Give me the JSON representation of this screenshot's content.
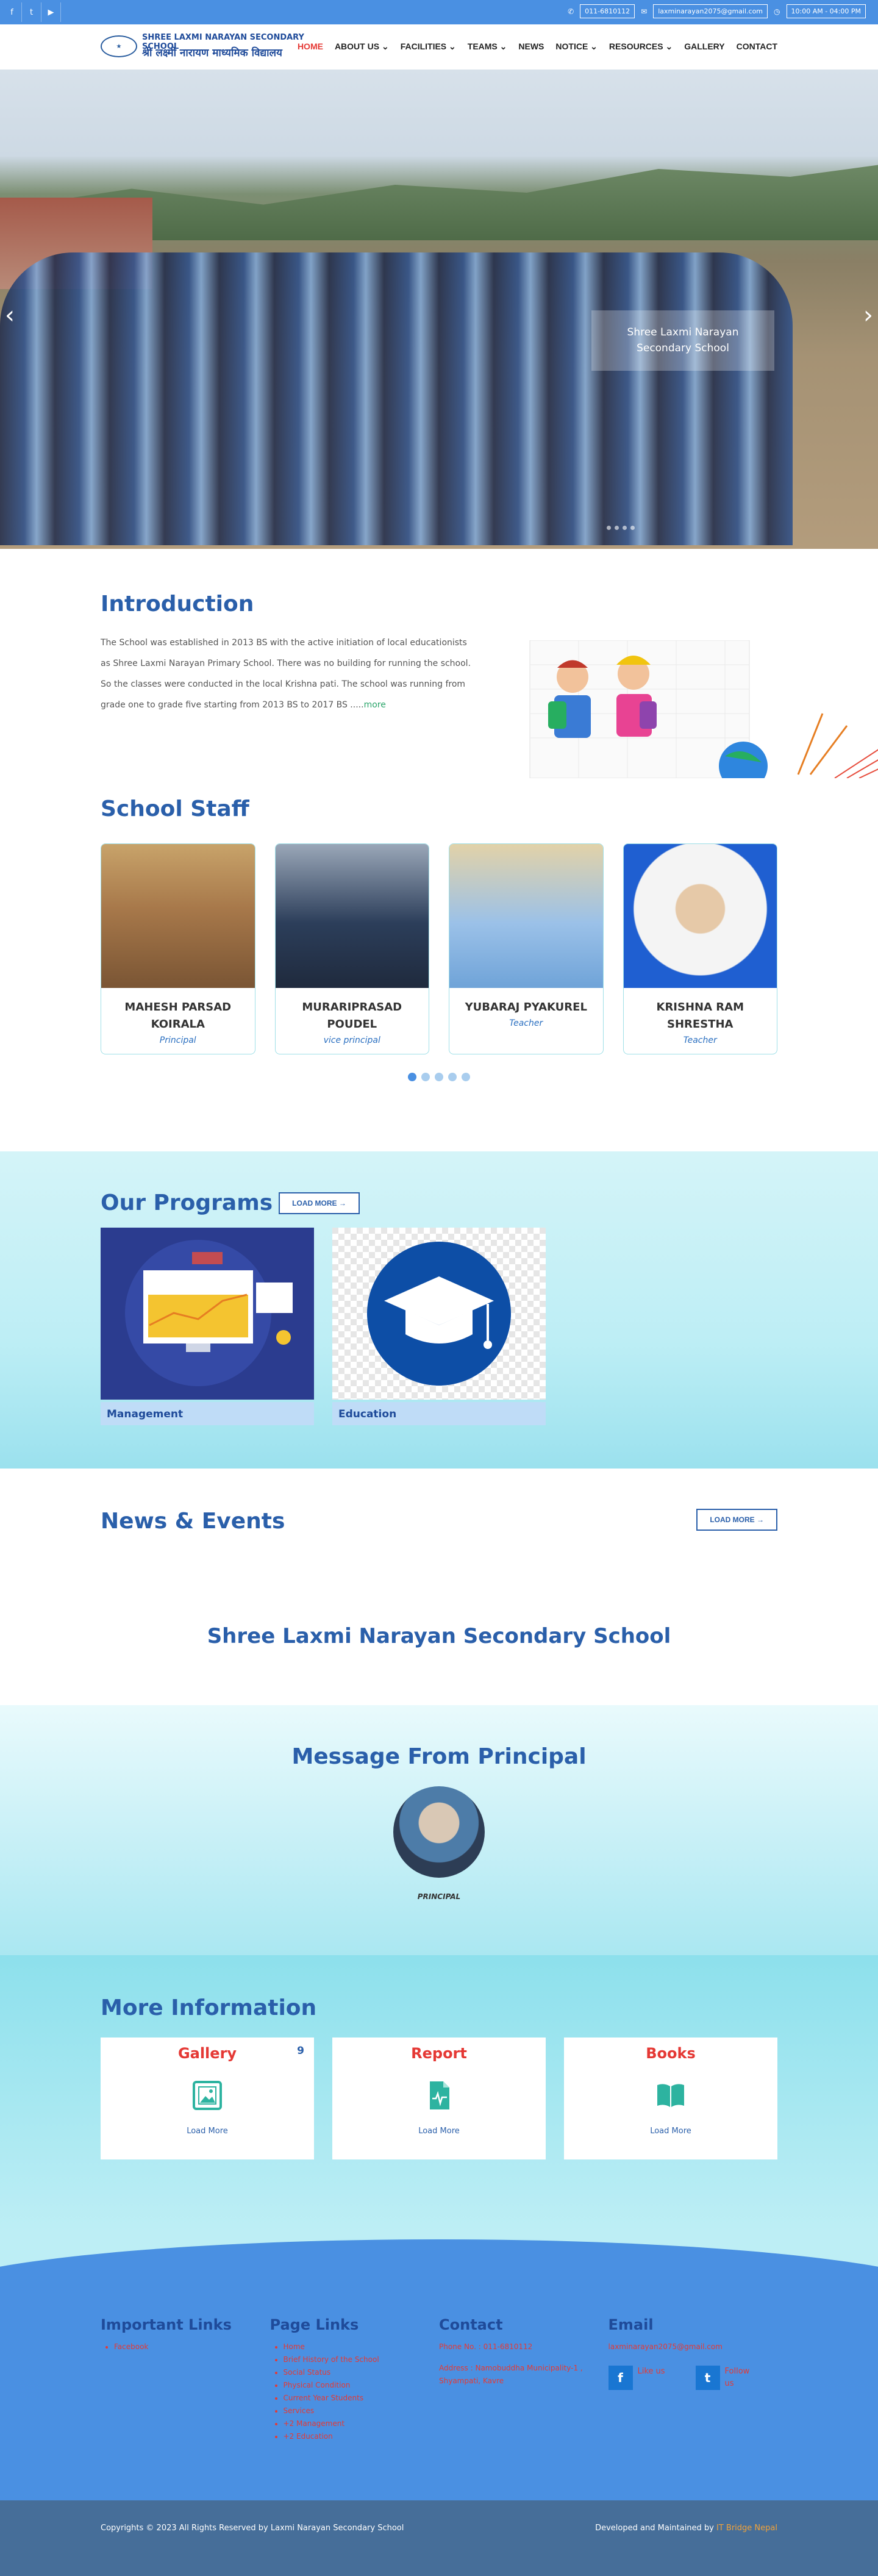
{
  "topbar": {
    "social": [
      {
        "icon": "facebook-icon",
        "glyph": "f"
      },
      {
        "icon": "twitter-icon",
        "glyph": "t"
      },
      {
        "icon": "youtube-icon",
        "glyph": "▶"
      }
    ],
    "phone": "011-6810112",
    "email": "laxminarayan2075@gmail.com",
    "hours": "10:00 AM - 04:00 PM"
  },
  "logo": {
    "line1": "SHREE LAXMI NARAYAN SECONDARY SCHOOL",
    "line2": "श्री लक्ष्मी नारायण माध्यमिक विद्यालय"
  },
  "nav": {
    "items": [
      "HOME",
      "ABOUT US",
      "FACILITIES",
      "TEAMS",
      "NEWS",
      "NOTICE",
      "RESOURCES",
      "GALLERY",
      "CONTACT"
    ]
  },
  "hero": {
    "caption": "Shree Laxmi Narayan Secondary School"
  },
  "intro": {
    "title": "Introduction",
    "text": "The School was established in 2013 BS with the active initiation of local educationists as Shree Laxmi Narayan Primary School. There was no building for running the school. So the classes were conducted in the local Krishna pati. The school was running from grade one to grade five starting from 2013 BS to 2017 BS .....",
    "more": "more"
  },
  "staff": {
    "title": "School Staff",
    "members": [
      {
        "name": "MAHESH PARSAD KOIRALA",
        "role": "Principal"
      },
      {
        "name": "MURARIPRASAD POUDEL",
        "role": "vice principal"
      },
      {
        "name": "YUBARAJ PYAKUREL",
        "role": "Teacher"
      },
      {
        "name": "KRISHNA RAM SHRESTHA",
        "role": "Teacher"
      }
    ]
  },
  "programs": {
    "title": "Our Programs",
    "load_more": "LOAD MORE",
    "items": [
      {
        "label": "Management"
      },
      {
        "label": "Education"
      }
    ]
  },
  "news": {
    "title": "News & Events",
    "load_more": "LOAD MORE",
    "school": "Shree Laxmi Narayan Secondary School"
  },
  "principal": {
    "title": "Message From Principal",
    "role": "PRINCIPAL"
  },
  "more_info": {
    "title": "More Information",
    "cards": [
      {
        "title": "Gallery",
        "badge": "9",
        "icon": "image-icon",
        "link": "Load More"
      },
      {
        "title": "Report",
        "badge": "",
        "icon": "file-chart-icon",
        "link": "Load More"
      },
      {
        "title": "Books",
        "badge": "",
        "icon": "book-icon",
        "link": "Load More"
      }
    ]
  },
  "footer": {
    "important_links": {
      "title": "Important Links",
      "items": [
        "Facebook"
      ]
    },
    "page_links": {
      "title": "Page Links",
      "items": [
        "Home",
        "Brief History of the School",
        "Social Status",
        "Physical Condition",
        "Current Year Students",
        "Services",
        "+2 Management",
        "+2 Education"
      ]
    },
    "contact": {
      "title": "Contact",
      "phone": "Phone No. : 011-6810112",
      "address": "Address : Namobuddha Municipality-1 , Shyampati, Kavre"
    },
    "email": {
      "title": "Email",
      "address": "laxminarayan2075@gmail.com",
      "like": "Like us",
      "follow": "Follow us"
    }
  },
  "bottombar": {
    "copyright": "Copyrights © 2023 All Rights Reserved by Laxmi Narayan Secondary School",
    "maintained": "Developed and Maintained by",
    "brand": "IT Bridge Nepal"
  },
  "colors": {
    "primary": "#4a90e2",
    "heading": "#2a5faa",
    "accent_red": "#e53935",
    "teal": "#2db3a0"
  }
}
